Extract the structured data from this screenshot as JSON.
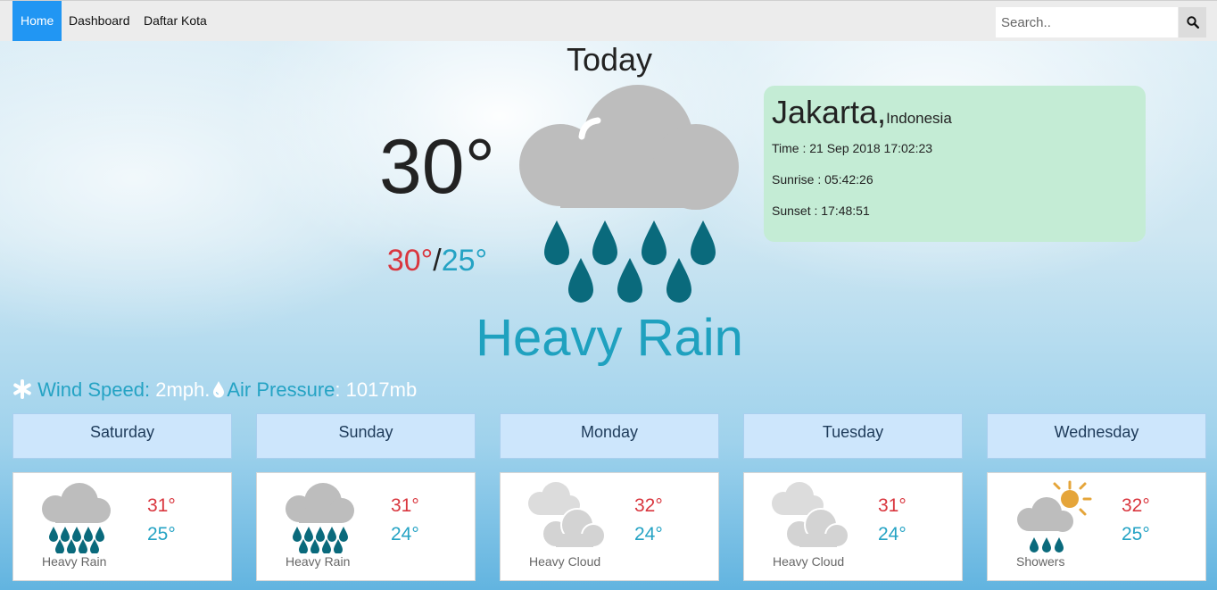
{
  "nav": {
    "items": [
      {
        "label": "Home",
        "active": true
      },
      {
        "label": "Dashboard",
        "active": false
      },
      {
        "label": "Daftar Kota",
        "active": false
      }
    ],
    "search_placeholder": "Search.."
  },
  "today": {
    "heading": "Today",
    "temp": "30°",
    "high": "30°",
    "sep": "/",
    "low": "25°",
    "condition": "Heavy Rain",
    "icon": "heavy-rain-icon"
  },
  "location": {
    "city": "Jakarta,",
    "country": "Indonesia",
    "time": "Time : 21 Sep 2018 17:02:23",
    "sunrise": "Sunrise : 05:42:26",
    "sunset": "Sunset : 17:48:51"
  },
  "stats": {
    "wind_label": "Wind Speed:",
    "wind_value": "2mph.",
    "pressure_label": "Air Pressure",
    "pressure_sep": ":",
    "pressure_value": "1017mb"
  },
  "forecast": [
    {
      "day": "Saturday",
      "high": "31°",
      "low": "25°",
      "condition": "Heavy Rain",
      "icon": "heavy-rain-icon"
    },
    {
      "day": "Sunday",
      "high": "31°",
      "low": "24°",
      "condition": "Heavy Rain",
      "icon": "heavy-rain-icon"
    },
    {
      "day": "Monday",
      "high": "32°",
      "low": "24°",
      "condition": "Heavy Cloud",
      "icon": "heavy-cloud-icon"
    },
    {
      "day": "Tuesday",
      "high": "31°",
      "low": "24°",
      "condition": "Heavy Cloud",
      "icon": "heavy-cloud-icon"
    },
    {
      "day": "Wednesday",
      "high": "32°",
      "low": "25°",
      "condition": "Showers",
      "icon": "showers-icon"
    }
  ],
  "colors": {
    "accent": "#2196f3",
    "high_temp": "#d9363e",
    "low_temp": "#25a3c4",
    "rain_drop": "#0a6a7c",
    "info_card": "#c4ecd5"
  }
}
